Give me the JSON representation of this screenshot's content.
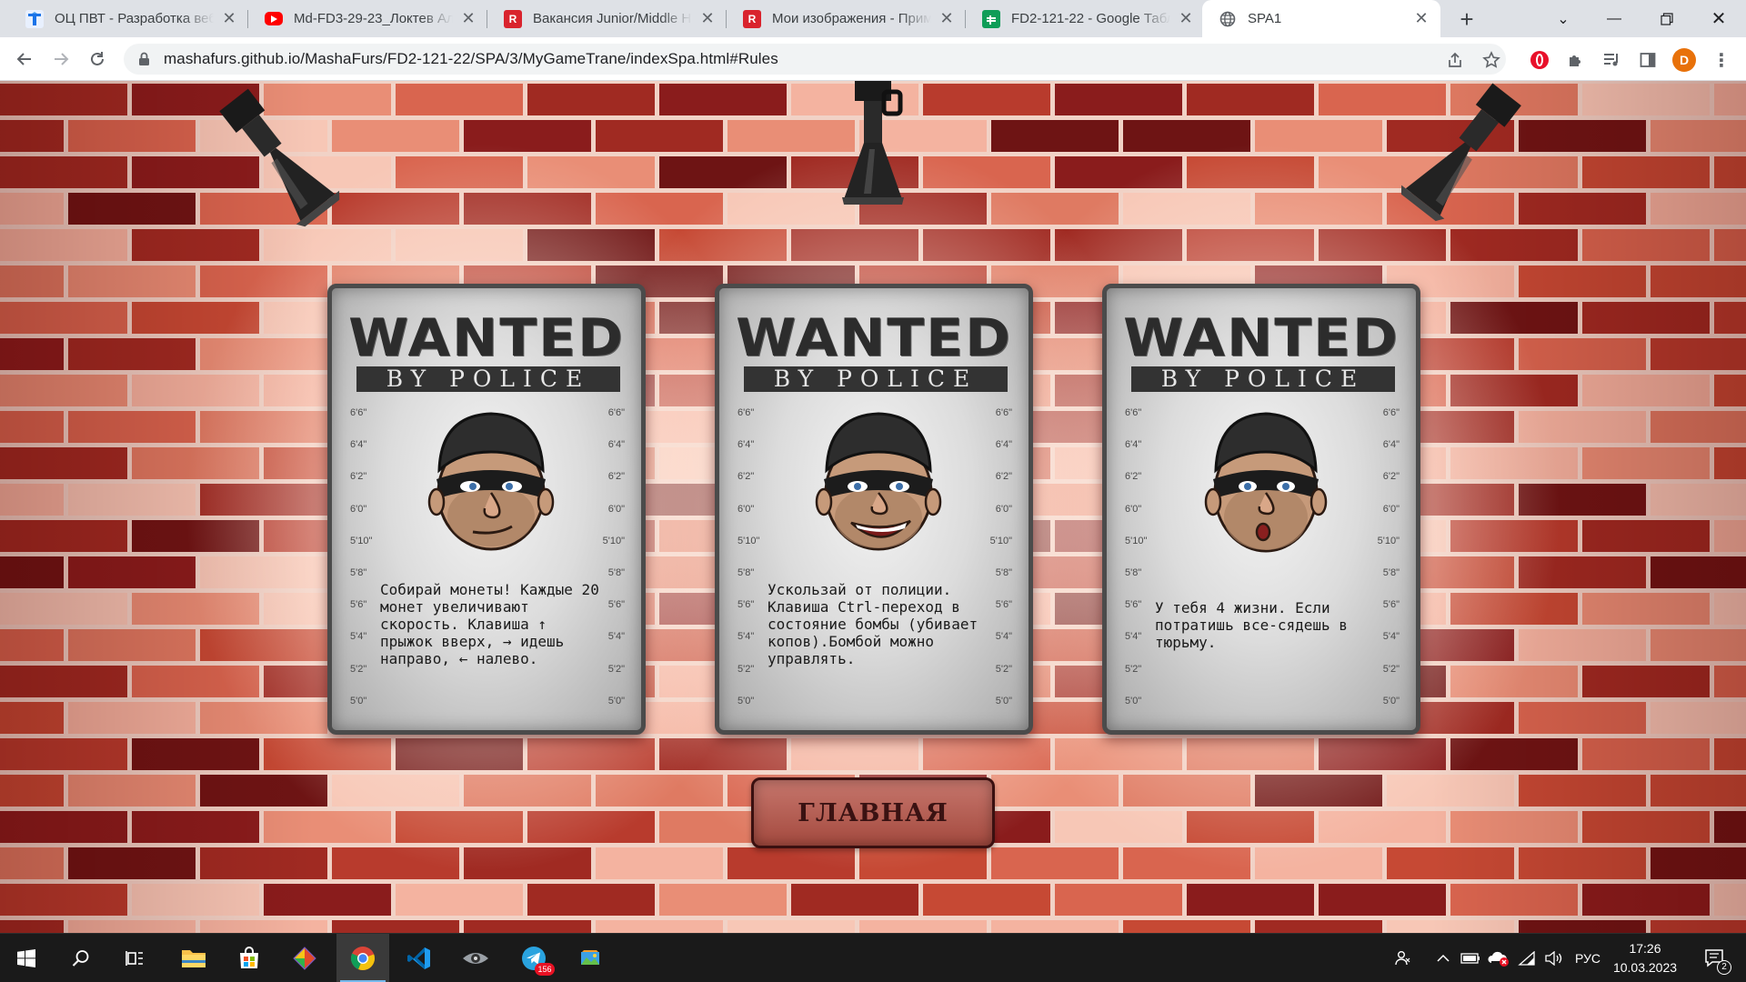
{
  "browser": {
    "tabs": [
      {
        "title": "ОЦ ПВТ - Разработка веб-",
        "icon": "pvt-icon",
        "color": "#1a73e8"
      },
      {
        "title": "Md-FD3-29-23_Локтев Але",
        "icon": "youtube-icon",
        "color": "#ff0000"
      },
      {
        "title": "Вакансия Junior/Middle HT",
        "icon": "r-icon",
        "color": "#d9232d"
      },
      {
        "title": "Мои изображения - Прим",
        "icon": "r-icon",
        "color": "#d9232d"
      },
      {
        "title": "FD2-121-22 - Google Табл",
        "icon": "sheets-icon",
        "color": "#0f9d58"
      },
      {
        "title": "SPA1",
        "icon": "globe-icon",
        "color": "#5f6368"
      }
    ],
    "active_tab": 5,
    "url": "mashafurs.github.io/MashaFurs/FD2-121-22/SPA/3/MyGameTrane/indexSpa.html#Rules",
    "avatar_letter": "D"
  },
  "page": {
    "posters": [
      {
        "heading": "WANTED",
        "subheading": "BY POLICE",
        "text": "Собирай монеты! Каждые 20 монет увеличивают скорость. Клавиша ↑ прыжок вверх, → идешь направо, ← налево."
      },
      {
        "heading": "WANTED",
        "subheading": "BY POLICE",
        "text": "Ускользай от полиции. Клавиша Ctrl-переход в состояние бомбы (убивает копов).Бомбой можно управлять."
      },
      {
        "heading": "WANTED",
        "subheading": "BY POLICE",
        "text": "У тебя 4 жизни. Если потратишь все-сядешь в тюрьму."
      }
    ],
    "height_scale": [
      "6'6\"",
      "6'4\"",
      "6'2\"",
      "6'0\"",
      "5'10\"",
      "5'8\"",
      "5'6\"",
      "5'4\"",
      "5'2\"",
      "5'0\""
    ],
    "main_button": "ГЛАВНАЯ"
  },
  "taskbar": {
    "apps": [
      {
        "name": "file-explorer-icon"
      },
      {
        "name": "store-icon"
      },
      {
        "name": "git-icon"
      },
      {
        "name": "chrome-icon",
        "active": true
      },
      {
        "name": "vscode-icon"
      },
      {
        "name": "eye-app-icon"
      },
      {
        "name": "telegram-icon",
        "badge": "156"
      },
      {
        "name": "paint-icon"
      }
    ],
    "language": "РУС",
    "time": "17:26",
    "date": "10.03.2023",
    "notifications": "2"
  }
}
